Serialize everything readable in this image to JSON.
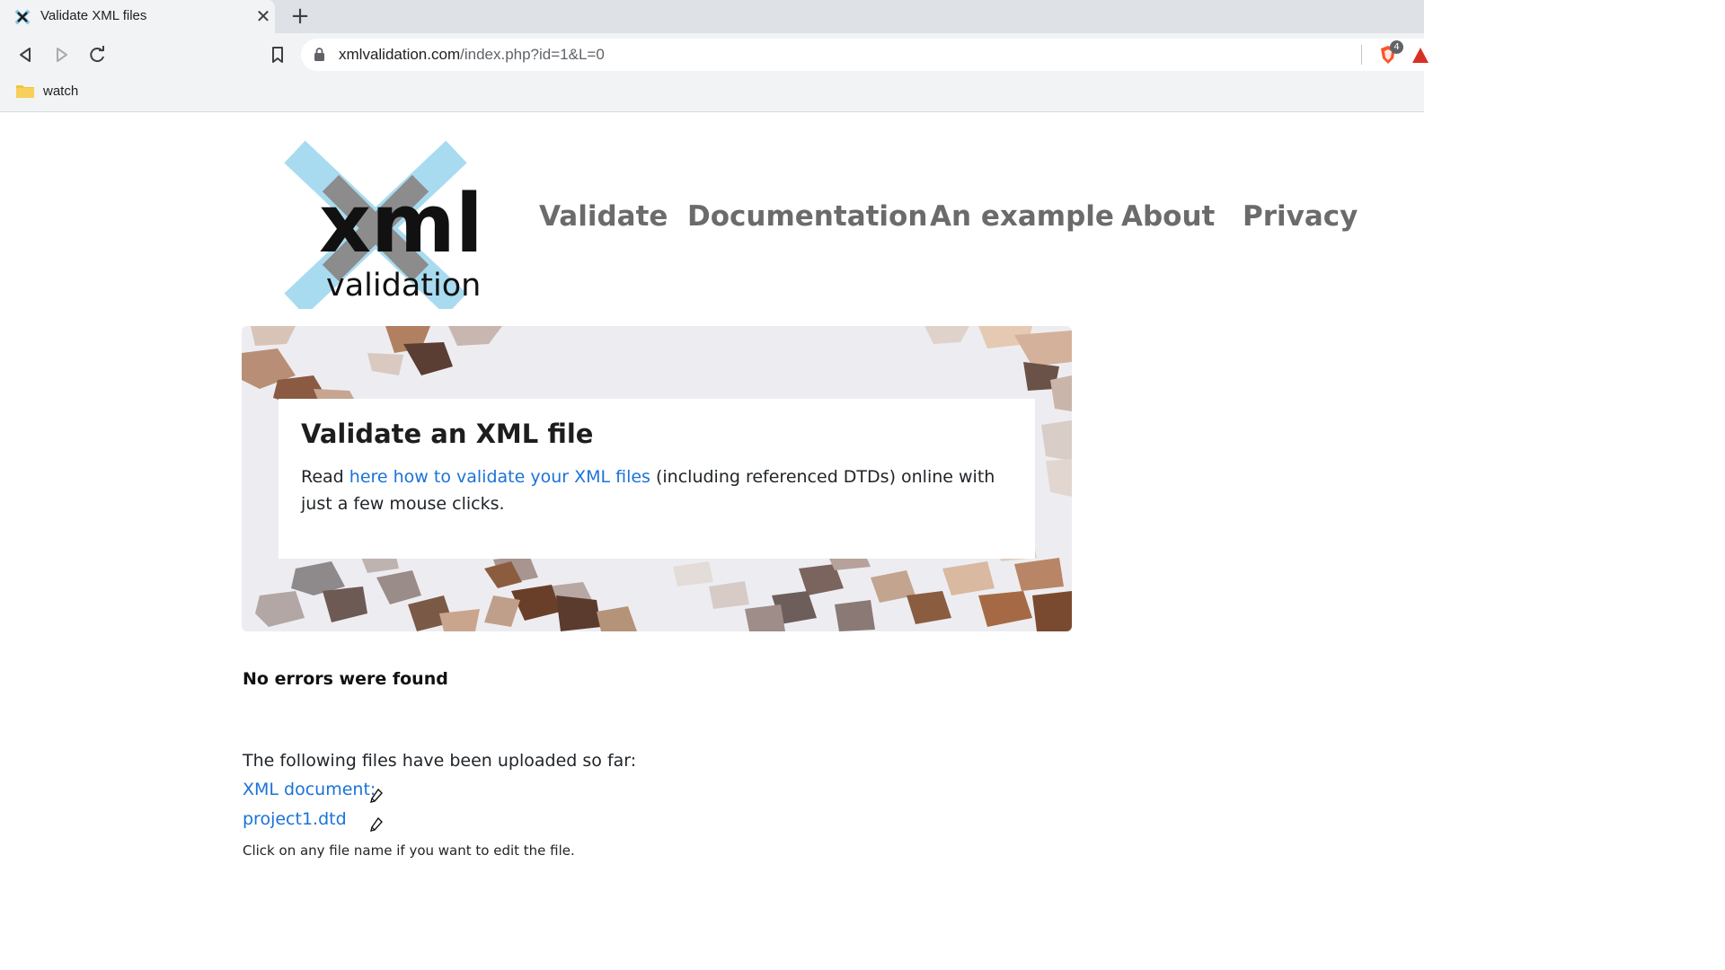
{
  "browser": {
    "tab": {
      "title": "Validate XML files",
      "close_symbol": "✕"
    },
    "new_tab_symbol": "+",
    "url_host": "xmlvalidation.com",
    "url_path": "/index.php?id=1&L=0",
    "shields_count": "4",
    "bookmarks": [
      {
        "label": "watch"
      }
    ]
  },
  "site": {
    "logo": {
      "primary": "xml",
      "secondary": "validation"
    },
    "nav": [
      {
        "label": "Validate"
      },
      {
        "label": "Documentation"
      },
      {
        "label": "An example"
      },
      {
        "label": "About"
      },
      {
        "label": "Privacy"
      }
    ]
  },
  "hero": {
    "title": "Validate an XML file",
    "text_before": "Read ",
    "link_text": "here how to validate your XML files",
    "text_after": " (including referenced DTDs) online with just a few mouse clicks."
  },
  "result": {
    "status": "No errors were found"
  },
  "uploads": {
    "intro": "The following files have been uploaded so far:",
    "files": [
      {
        "label": "XML document:"
      },
      {
        "label": "project1.dtd"
      }
    ],
    "hint": "Click on any file name if you want to edit the file."
  },
  "colors": {
    "link": "#1a73d8",
    "nav": "#6b6b6b",
    "logo_light_blue": "#a9dbf0",
    "logo_gray": "#8c8c8c"
  }
}
